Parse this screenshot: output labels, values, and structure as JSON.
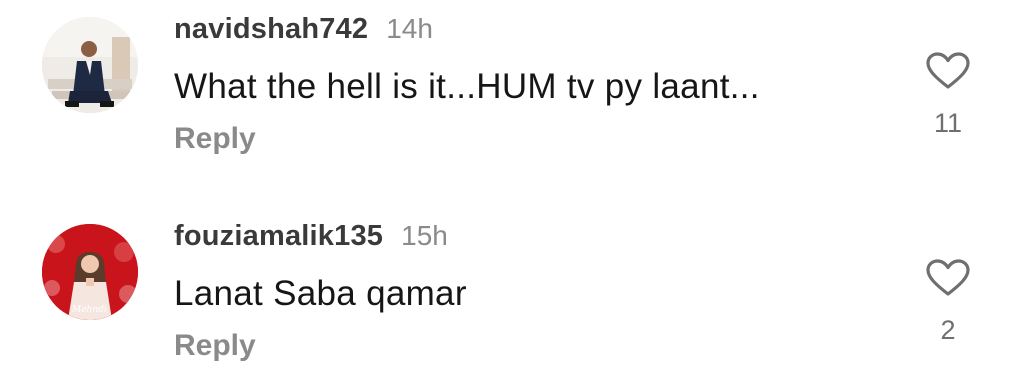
{
  "comments": [
    {
      "username": "navidshah742",
      "time": "14h",
      "text": "What the hell is it...HUM tv py laant...",
      "reply_label": "Reply",
      "like_count": "11"
    },
    {
      "username": "fouziamalik135",
      "time": "15h",
      "text": "Lanat Saba qamar",
      "reply_label": "Reply",
      "like_count": "2"
    }
  ],
  "colors": {
    "username": "#3a3a3a",
    "meta": "#8a8a8a",
    "text": "#161616",
    "heart": "#6f6f6f"
  }
}
